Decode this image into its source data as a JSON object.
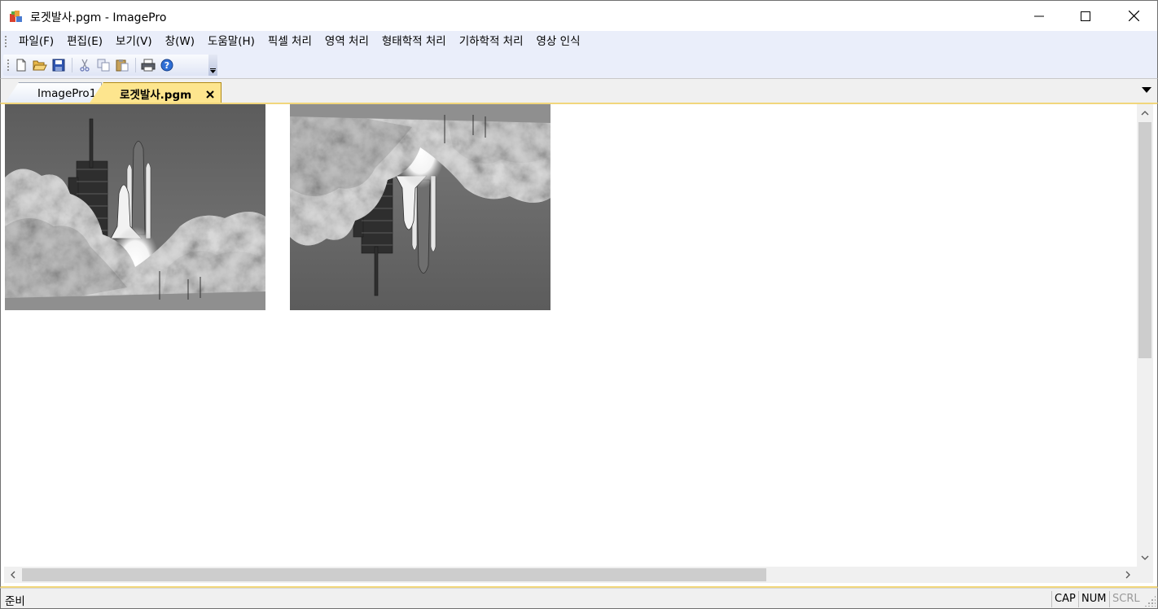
{
  "window": {
    "title": "로겟발사.pgm - ImagePro"
  },
  "menubar": {
    "items": [
      "파일(F)",
      "편집(E)",
      "보기(V)",
      "창(W)",
      "도움말(H)",
      "픽셀 처리",
      "영역 처리",
      "형태학적 처리",
      "기하학적 처리",
      "영상 인식"
    ]
  },
  "toolbar": {
    "buttons": [
      "new-icon",
      "open-icon",
      "save-icon",
      "cut-icon",
      "copy-icon",
      "paste-icon",
      "print-icon",
      "help-icon"
    ]
  },
  "tabs": [
    {
      "label": "ImagePro1",
      "active": false
    },
    {
      "label": "로겟발사.pgm",
      "active": true
    }
  ],
  "document": {
    "images": [
      "original",
      "flipped-vertical"
    ]
  },
  "statusbar": {
    "message": "준비",
    "indicators": [
      {
        "label": "CAP",
        "active": true
      },
      {
        "label": "NUM",
        "active": true
      },
      {
        "label": "SCRL",
        "active": false
      }
    ]
  },
  "colors": {
    "active_tab": "#fde58e",
    "menubar_bg": "#eaeefa",
    "frame_accent": "#f1d67c"
  }
}
